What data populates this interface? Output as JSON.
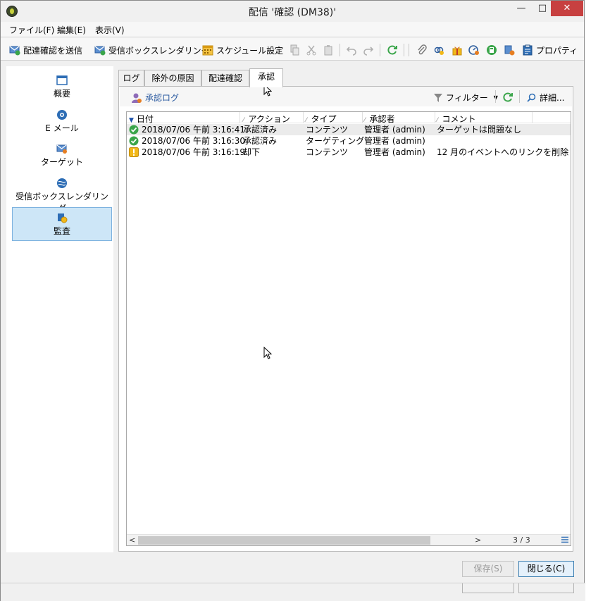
{
  "window": {
    "title": "配信 '確認 (DM38)'",
    "min_label": "—",
    "max_label": "□",
    "close_label": "✕"
  },
  "menu": [
    "ファイル(F)",
    "編集(E)",
    "表示(V)"
  ],
  "toolbar": {
    "send_proof": "配達確認を送信",
    "inbox_rendering": "受信ボックスレンダリング",
    "schedule": "スケジュール設定",
    "properties": "プロパティ"
  },
  "sidebar": {
    "items": [
      {
        "label": "概要",
        "icon": "overview-icon"
      },
      {
        "label": "E メール",
        "icon": "email-icon"
      },
      {
        "label": "ターゲット",
        "icon": "target-icon"
      },
      {
        "label": "受信ボックスレンダリング",
        "icon": "inbox-rendering-icon"
      },
      {
        "label": "監査",
        "icon": "audit-icon",
        "active": true
      }
    ]
  },
  "tabs": [
    "ログ",
    "除外の原因",
    "配達確認",
    "承認"
  ],
  "active_tab": "承認",
  "panel": {
    "title": "承認ログ",
    "filter": "フィルター",
    "detail": "詳細..."
  },
  "grid": {
    "columns": [
      "日付",
      "アクション",
      "タイプ",
      "承認者",
      "コメント"
    ],
    "rows": [
      {
        "status": "approved",
        "date": "2018/07/06 午前 3:16:41",
        "action": "承認済み",
        "type": "コンテンツ",
        "approver": "管理者 (admin)",
        "comment": "ターゲットは問題なし"
      },
      {
        "status": "approved",
        "date": "2018/07/06 午前 3:16:30",
        "action": "承認済み",
        "type": "ターゲティング",
        "approver": "管理者 (admin)",
        "comment": ""
      },
      {
        "status": "warning",
        "date": "2018/07/06 午前 3:16:19",
        "action": "却下",
        "type": "コンテンツ",
        "approver": "管理者 (admin)",
        "comment": "12 月のイベントへのリンクを削除"
      }
    ],
    "count": "3 / 3"
  },
  "footer": {
    "save": "保存(S)",
    "close": "閉じる(C)"
  },
  "colors": {
    "accent": "#2a5aa0",
    "sidebar_active": "#cde6f7",
    "approved": "#3aa54a",
    "warning": "#f2b818",
    "close_button": "#c74040"
  }
}
